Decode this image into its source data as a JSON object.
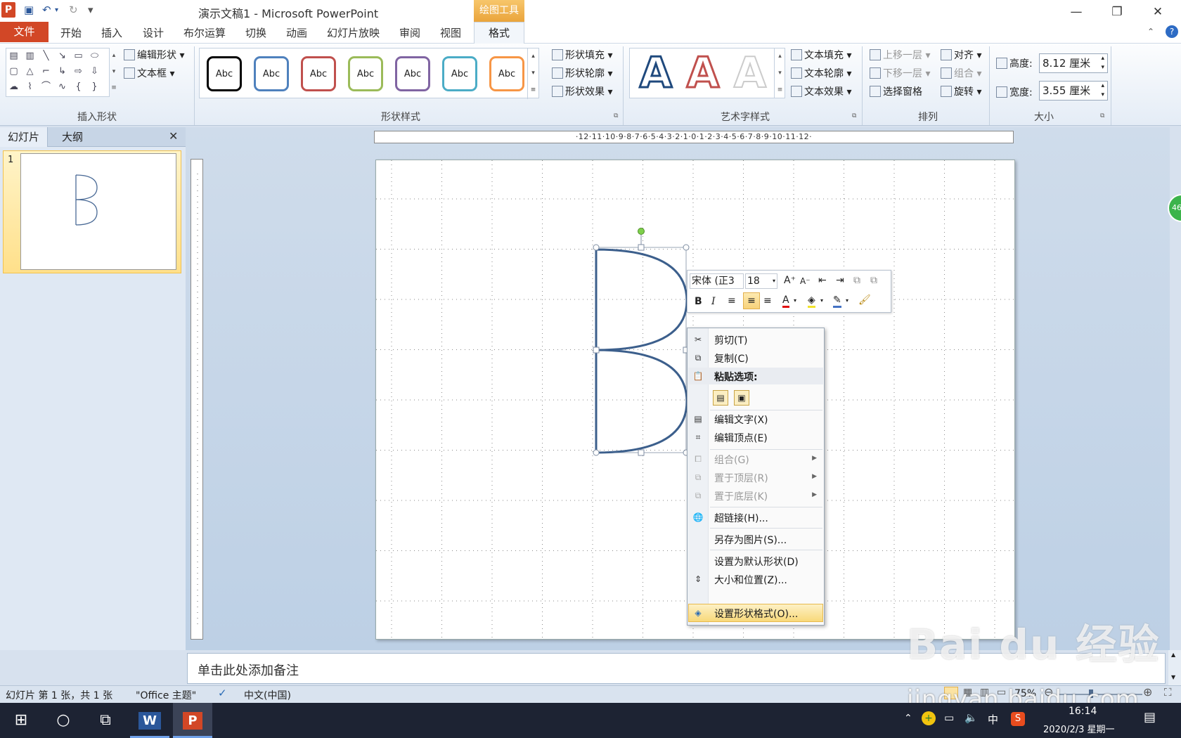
{
  "window": {
    "title": "演示文稿1 - Microsoft PowerPoint",
    "context_tools": "绘图工具"
  },
  "tabs": {
    "file": "文件",
    "home": "开始",
    "insert": "插入",
    "design": "设计",
    "boolean": "布尔运算",
    "transitions": "切换",
    "animations": "动画",
    "slideshow": "幻灯片放映",
    "review": "审阅",
    "view": "视图",
    "format": "格式"
  },
  "ribbon": {
    "insert_shapes": {
      "label": "插入形状",
      "edit_shape": "编辑形状",
      "text_box": "文本框"
    },
    "shape_styles": {
      "label": "形状样式",
      "abc": "Abc",
      "fill": "形状填充",
      "outline": "形状轮廓",
      "effects": "形状效果",
      "style_colors": [
        "#000000",
        "#4f81bd",
        "#c0504d",
        "#9bbb59",
        "#8064a2",
        "#4bacc6",
        "#f79646"
      ]
    },
    "wordart": {
      "label": "艺术字样式",
      "letter": "A",
      "text_fill": "文本填充",
      "text_outline": "文本轮廓",
      "text_effects": "文本效果"
    },
    "arrange": {
      "label": "排列",
      "bring_forward": "上移一层",
      "send_backward": "下移一层",
      "selection_pane": "选择窗格",
      "align": "对齐",
      "group": "组合",
      "rotate": "旋转"
    },
    "size": {
      "label": "大小",
      "height_label": "高度:",
      "height": "8.12 厘米",
      "width_label": "宽度:",
      "width": "3.55 厘米"
    }
  },
  "left_pane": {
    "tab_slides": "幻灯片",
    "tab_outline": "大纲",
    "slide_number": "1"
  },
  "rulers": {
    "horizontal": "·12·11·10·9·8·7·6·5·4·3·2·1·0·1·2·3·4·5·6·7·8·9·10·11·12·"
  },
  "minibar": {
    "font": "宋体 (正3",
    "size": "18",
    "bold": "B",
    "italic": "I",
    "font_color_glyph": "A"
  },
  "context_menu": {
    "cut": "剪切(T)",
    "copy": "复制(C)",
    "paste_options": "粘贴选项:",
    "edit_text": "编辑文字(X)",
    "edit_points": "编辑顶点(E)",
    "group": "组合(G)",
    "bring_to_front": "置于顶层(R)",
    "send_to_back": "置于底层(K)",
    "hyperlink": "超链接(H)...",
    "save_as_picture": "另存为图片(S)...",
    "set_default": "设置为默认形状(D)",
    "size_position": "大小和位置(Z)...",
    "format_shape": "设置形状格式(O)..."
  },
  "notes": {
    "placeholder": "单击此处添加备注"
  },
  "status_bar": {
    "slide_info": "幻灯片 第 1 张，共 1 张",
    "theme": "\"Office 主题\"",
    "language": "中文(中国)",
    "zoom": "75%"
  },
  "badge": "46",
  "taskbar": {
    "time": "16:14",
    "date": "2020/2/3 星期一",
    "ime": "中"
  },
  "watermark": {
    "line1": "Bai du 经验",
    "line2": "jingyan.baidu.com"
  }
}
